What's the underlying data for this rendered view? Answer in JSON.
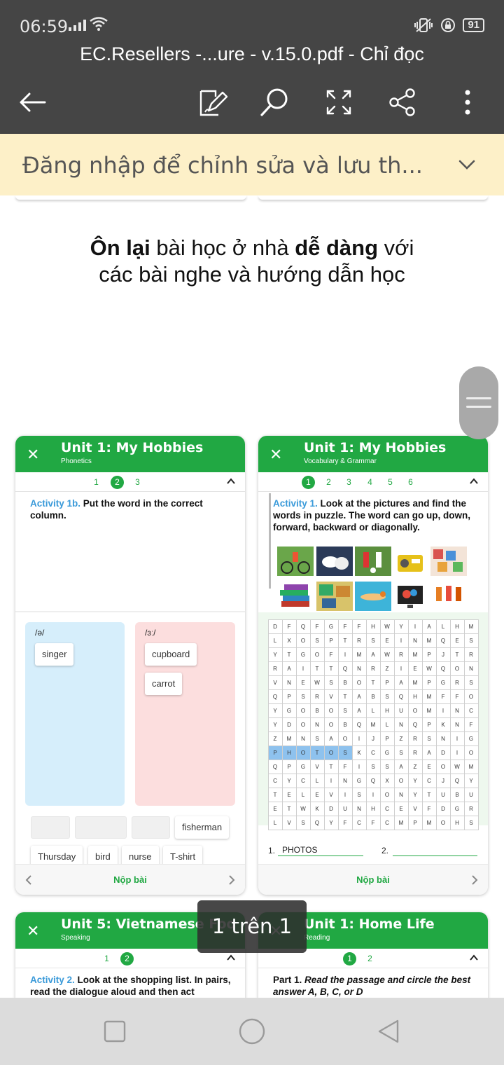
{
  "status_bar": {
    "time": "06:59",
    "battery": "91"
  },
  "app_bar": {
    "title": "EC.Resellers -...ure - v.15.0.pdf - Chỉ đọc"
  },
  "banner": {
    "text": "Đăng nhập để chỉnh sửa và lưu th..."
  },
  "headline": {
    "bold1": "Ôn lại",
    "text1": " bài học ở nhà ",
    "bold2": "dễ dàng",
    "text2": " với",
    "line2": "các bài nghe và hướng dẫn học"
  },
  "card1": {
    "title": "Unit 1: My Hobbies",
    "subtitle": "Phonetics",
    "steps": [
      "1",
      "2",
      "3"
    ],
    "activity_label": "Activity 1b.",
    "activity_text": " Put the word in the correct column.",
    "col1_header": "/ə/",
    "col2_header": "/ɜː/",
    "col1_words": [
      "singer"
    ],
    "col2_words": [
      "cupboard",
      "carrot"
    ],
    "bank_row1": [
      "fisherman"
    ],
    "bank_row2": [
      "Thursday",
      "bird",
      "nurse",
      "T-shirt"
    ],
    "submit": "Nộp bài"
  },
  "card2": {
    "title": "Unit 1: My Hobbies",
    "subtitle": "Vocabulary & Grammar",
    "steps": [
      "1",
      "2",
      "3",
      "4",
      "5",
      "6"
    ],
    "activity_label": "Activity 1.",
    "activity_text": " Look at the pictures and find the words in puzzle. The word can go up, down, forward, backward or diagonally.",
    "grid": [
      "DFQFGFFHWYIALHM",
      "LXOSPTRSEINMQES",
      "YTGOFIMAWRMPJTR",
      "RAITTQNRZIEWQON",
      "VNEWSBOTPAMPGRS",
      "QPSRVTABSQHMFFO",
      "YGOBOSALHUOMINC",
      "YDONOBQMLNQPKNF",
      "ZMNSAOIJPZRSNIG",
      "PHOTOSKCGSRADIO",
      "QPGVTFISSAZEOWM",
      "CYCLINGQXOYCJQY",
      "TELEVISIONYTUBU",
      "ETWKDUNHCEVFDGR",
      "LVSQYFCFCMPMOHS"
    ],
    "answer1_num": "1.",
    "answer1": "PHOTOS",
    "answer2_num": "2.",
    "submit": "Nộp bài"
  },
  "card3": {
    "title": "Unit 5: Vietnamese Foo",
    "subtitle": "Speaking",
    "steps": [
      "1",
      "2"
    ],
    "activity_label": "Activity 2.",
    "activity_text": " Look at the shopping list. In pairs, read the dialogue aloud and then act"
  },
  "card4": {
    "title": "Unit 1: Home Life",
    "subtitle": "Reading",
    "steps": [
      "1",
      "2"
    ],
    "part_label": "Part 1.",
    "part_text": " Read the passage and circle the best answer A, B, C, or D"
  },
  "page_indicator": "1 trên 1",
  "colors": {
    "green": "#21a843",
    "blue_label": "#3a9ad9",
    "col1_bg": "#d6eefb",
    "col2_bg": "#fcdede",
    "bar": "#454545",
    "banner": "#fdf0c8"
  }
}
